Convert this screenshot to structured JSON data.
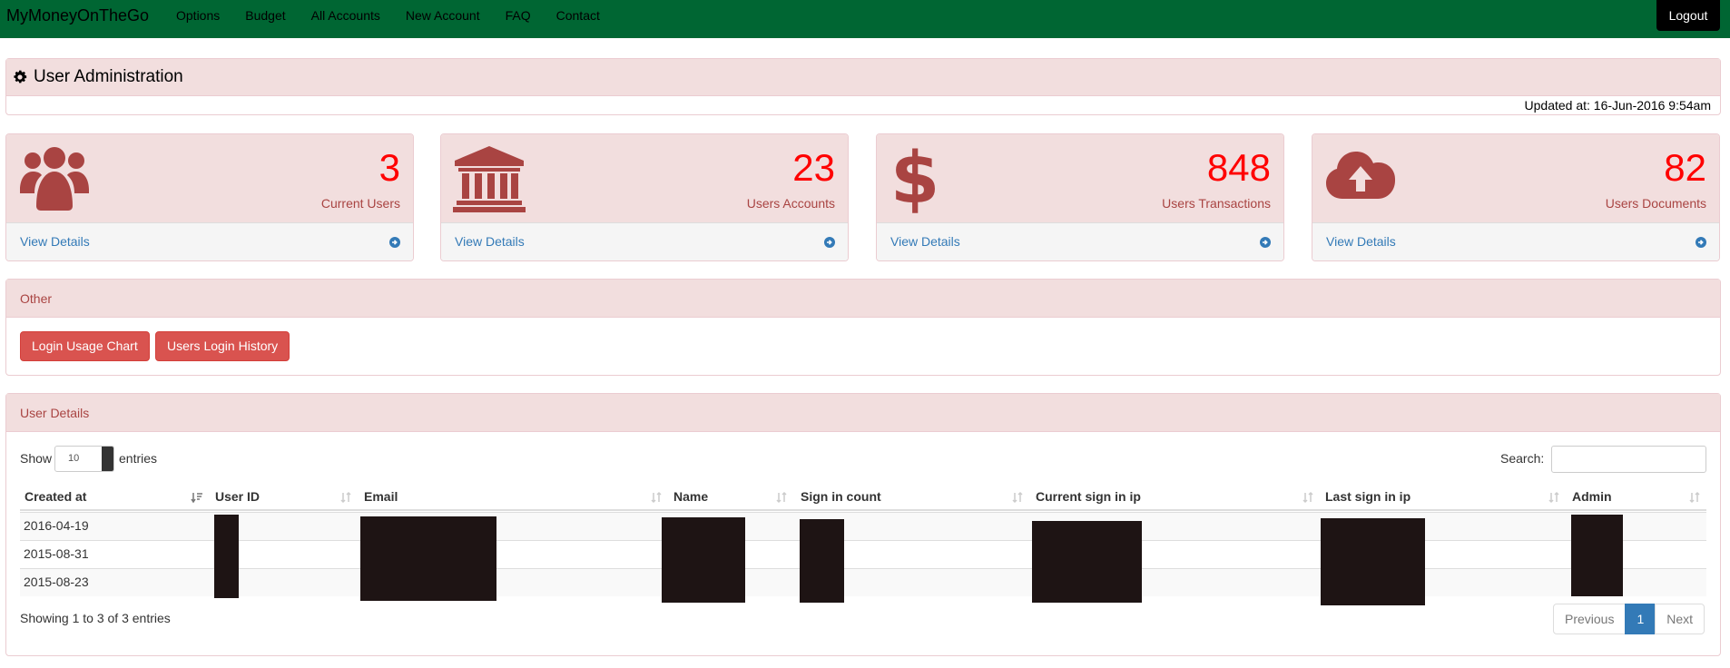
{
  "navbar": {
    "brand": "MyMoneyOnTheGo",
    "links": [
      "Options",
      "Budget",
      "All Accounts",
      "New Account",
      "FAQ",
      "Contact"
    ],
    "logout": "Logout"
  },
  "header": {
    "title": "User Administration",
    "icon": "gear-icon",
    "updated": "Updated at: 16-Jun-2016 9:54am"
  },
  "cards": [
    {
      "value": "3",
      "label": "Current Users",
      "icon": "users-icon",
      "link": "View Details"
    },
    {
      "value": "23",
      "label": "Users Accounts",
      "icon": "bank-icon",
      "link": "View Details"
    },
    {
      "value": "848",
      "label": "Users Transactions",
      "icon": "dollar-icon",
      "link": "View Details"
    },
    {
      "value": "82",
      "label": "Users Documents",
      "icon": "cloud-upload-icon",
      "link": "View Details"
    }
  ],
  "other": {
    "title": "Other",
    "buttons": [
      "Login Usage Chart",
      "Users Login History"
    ]
  },
  "user_details": {
    "title": "User Details",
    "show_label": "Show",
    "page_size": "10",
    "entries_label": "entries",
    "search_label": "Search:",
    "columns": [
      "Created at",
      "User ID",
      "Email",
      "Name",
      "Sign in count",
      "Current sign in ip",
      "Last sign in ip",
      "Admin"
    ],
    "rows": [
      {
        "created_at": "2016-04-19"
      },
      {
        "created_at": "2015-08-31"
      },
      {
        "created_at": "2015-08-23"
      }
    ],
    "showing": "Showing 1 to 3 of 3 entries",
    "pagination": {
      "previous": "Previous",
      "current": "1",
      "next": "Next"
    }
  },
  "colors": {
    "navbar": "#006633",
    "panel_heading": "#f2dede",
    "danger": "#d9534f",
    "stat_value": "#ff0000",
    "link": "#337ab7"
  }
}
